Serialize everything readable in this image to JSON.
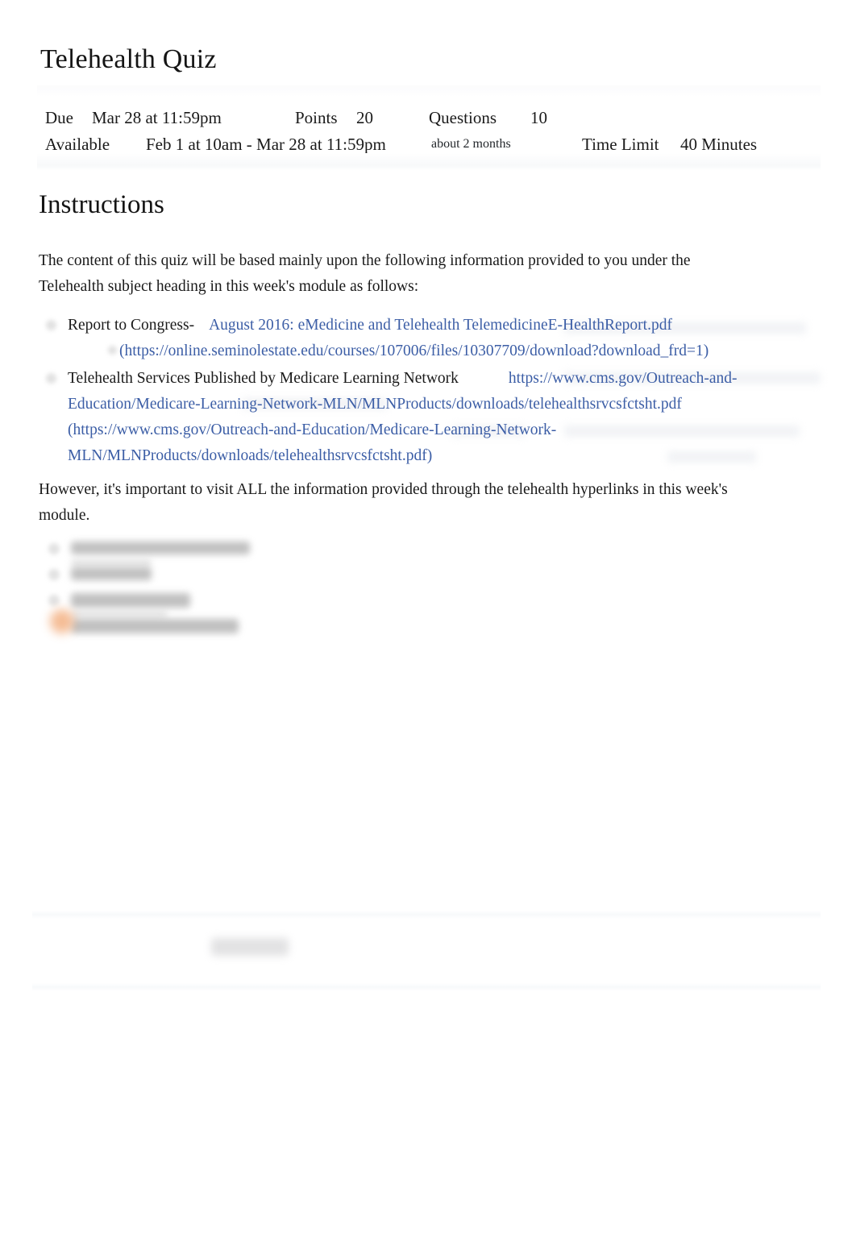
{
  "page": {
    "title": "Telehealth Quiz"
  },
  "meta": {
    "due_label": "Due",
    "due_value": "Mar 28 at 11:59pm",
    "points_label": "Points",
    "points_value": "20",
    "questions_label": "Questions",
    "questions_value": "10",
    "available_label": "Available",
    "available_value": "Feb 1 at 10am - Mar 28 at 11:59pm",
    "duration_note": "about 2 months",
    "time_limit_label": "Time Limit",
    "time_limit_value": "40 Minutes"
  },
  "instructions": {
    "heading": "Instructions",
    "intro": "The content of this quiz will be based mainly upon the following information provided to you under the Telehealth subject heading in this week's module as follows:",
    "outro": "However, it's important to visit ALL the information provided through the telehealth hyperlinks in this week's module."
  },
  "resources": [
    {
      "label": "Report to Congress-",
      "link_text": "August 2016: eMedicine and Telehealth TelemedicineE-HealthReport.pdf",
      "url_text": "(https://online.seminolestate.edu/courses/107006/files/10307709/download?download_frd=1)"
    },
    {
      "label": "Telehealth Services Published by Medicare Learning Network",
      "link_text": "https://www.cms.gov/Outreach-and-Education/Medicare-Learning-Network-MLN/MLNProducts/downloads/telehealthsrvcsfctsht.pdf",
      "url_text": "(https://www.cms.gov/Outreach-and-Education/Medicare-Learning-Network-MLN/MLNProducts/downloads/telehealthsrvcsfctsht.pdf)"
    }
  ],
  "colors": {
    "link": "#3c5ea6",
    "text": "#1a1a1a",
    "accent_blob": "#f3b183"
  },
  "redacted": {
    "note": "blurred illegible list content"
  }
}
